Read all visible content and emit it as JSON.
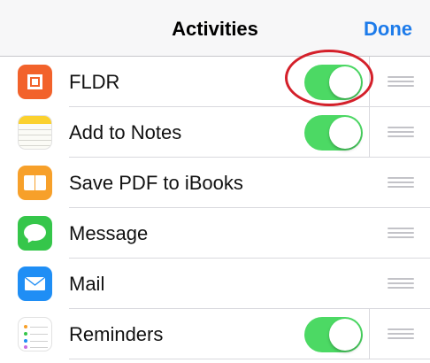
{
  "navbar": {
    "title": "Activities",
    "done_label": "Done"
  },
  "colors": {
    "accent": "#1d7bea",
    "toggle_on": "#4cd964",
    "highlight_ring": "#d4202a"
  },
  "activities": [
    {
      "label": "FLDR",
      "icon": "fldr-app-icon",
      "toggle": "on"
    },
    {
      "label": "Add to Notes",
      "icon": "notes-app-icon",
      "toggle": "on"
    },
    {
      "label": "Save PDF to iBooks",
      "icon": "ibooks-app-icon",
      "toggle": null
    },
    {
      "label": "Message",
      "icon": "messages-app-icon",
      "toggle": null
    },
    {
      "label": "Mail",
      "icon": "mail-app-icon",
      "toggle": null
    },
    {
      "label": "Reminders",
      "icon": "reminders-app-icon",
      "toggle": "on"
    }
  ]
}
